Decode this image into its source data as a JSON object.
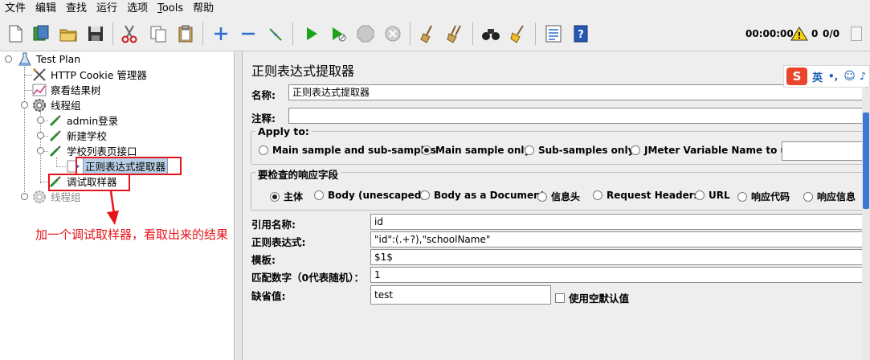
{
  "menu": [
    {
      "label": "文件"
    },
    {
      "label": "编辑"
    },
    {
      "label": "查找"
    },
    {
      "label": "运行"
    },
    {
      "label": "选项"
    },
    {
      "label": "Tools"
    },
    {
      "label": "帮助"
    }
  ],
  "toolbar": {
    "timer": "00:00:00",
    "warning_count": "0",
    "threads": "0/0"
  },
  "tree": {
    "test_plan": "Test Plan",
    "cookie_manager": "HTTP Cookie 管理器",
    "results_tree": "察看结果树",
    "thread_group_1": "线程组",
    "admin_login": "admin登录",
    "new_school": "新建学校",
    "school_list": "学校列表页接口",
    "regex_extractor": "正则表达式提取器",
    "debug_sampler": "调试取样器",
    "thread_group_2": "线程组"
  },
  "annotation": "加一个调试取样器，看取出来的结果",
  "panel": {
    "title": "正则表达式提取器",
    "name_label": "名称:",
    "name_value": "正则表达式提取器",
    "comment_label": "注释:",
    "comment_value": "",
    "apply_to": {
      "title": "Apply to:",
      "options": [
        "Main sample and sub-samples",
        "Main sample only",
        "Sub-samples only",
        "JMeter Variable Name to use"
      ],
      "selected_index": 1
    },
    "field_check": {
      "title": "要检查的响应字段",
      "options": [
        "主体",
        "Body (unescaped)",
        "Body as a Document",
        "信息头",
        "Request Headers",
        "URL",
        "响应代码",
        "响应信息"
      ],
      "selected_index": 0
    },
    "ref_name_label": "引用名称:",
    "ref_name_value": "id",
    "regex_label": "正则表达式:",
    "regex_value": "\"id\":(.+?),\"schoolName\"",
    "template_label": "模板:",
    "template_value": "$1$",
    "match_no_label": "匹配数字（0代表随机）：",
    "match_no_value": "1",
    "default_label": "缺省值:",
    "default_value": "test",
    "use_empty_label": "使用空默认值"
  },
  "ime": {
    "label": "英"
  },
  "colors": {
    "accent_red": "#e4141b",
    "selection": "#b8cfe5",
    "play_green": "#1aa31a"
  }
}
